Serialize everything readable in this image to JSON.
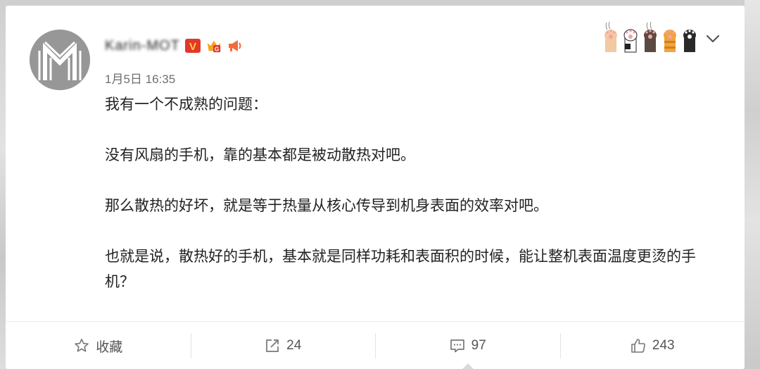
{
  "post": {
    "username": "Karin-MOT",
    "timestamp": "1月5日 16:35",
    "paragraphs": [
      "我有一个不成熟的问题：",
      "没有风扇的手机，靠的基本都是被动散热对吧。",
      "那么散热的好坏，就是等于热量从核心传导到机身表面的效率对吧。",
      "也就是说，散热好的手机，基本就是同样功耗和表面积的时候，能让整机表面温度更烫的手机？"
    ]
  },
  "badges": {
    "verified": "V",
    "level": "G"
  },
  "colors": {
    "verified": "#e0392b",
    "level": "#f5a623",
    "megaphone": "#f26b3a"
  },
  "footer": {
    "favorite_label": "收藏",
    "share_count": "24",
    "comment_count": "97",
    "like_count": "243"
  }
}
